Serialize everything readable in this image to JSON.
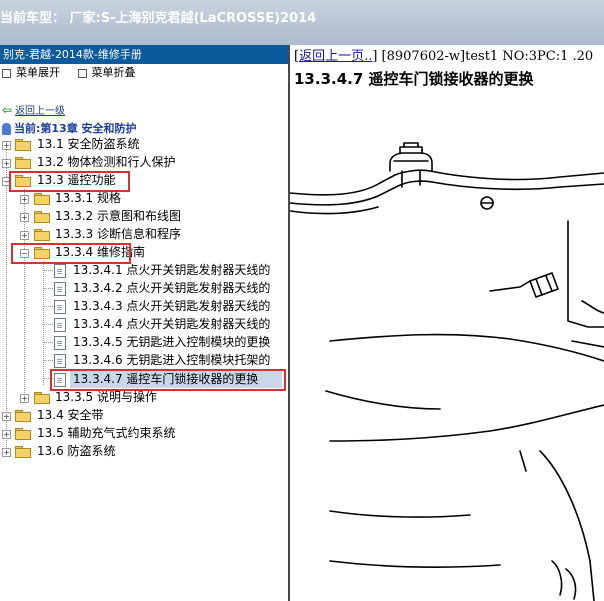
{
  "window": {
    "title": "当前车型： 厂家:S-上海别克君越(LaCROSSE)2014"
  },
  "left_panel": {
    "header": "别克-君越-2014款-维修手册",
    "toolbar": {
      "expand_label": "菜单展开",
      "collapse_label": "菜单折叠"
    },
    "up_link": "返回上一级",
    "current": "当前:第13章 安全和防护",
    "tree": [
      {
        "label": "13.1 安全防盗系统"
      },
      {
        "label": "13.2 物体检测和行人保护"
      },
      {
        "label": "13.3 遥控功能"
      },
      {
        "label": "13.3.1 规格"
      },
      {
        "label": "13.3.2 示意图和布线图"
      },
      {
        "label": "13.3.3 诊断信息和程序"
      },
      {
        "label": "13.3.4 维修指南"
      },
      {
        "label": "13.3.4.1 点火开关钥匙发射器天线的"
      },
      {
        "label": "13.3.4.2 点火开关钥匙发射器天线的"
      },
      {
        "label": "13.3.4.3 点火开关钥匙发射器天线的"
      },
      {
        "label": "13.3.4.4 点火开关钥匙发射器天线的"
      },
      {
        "label": "13.3.4.5 无钥匙进入控制模块的更换"
      },
      {
        "label": "13.3.4.6 无钥匙进入控制模块托架的"
      },
      {
        "label": "13.3.4.7 遥控车门锁接收器的更换"
      },
      {
        "label": "13.3.5 说明与操作"
      },
      {
        "label": "13.4 安全带"
      },
      {
        "label": "13.5 辅助充气式约束系统"
      },
      {
        "label": "13.6 防盗系统"
      }
    ]
  },
  "content": {
    "nav_prefix": "[",
    "back_link": "返回上一页..",
    "nav_info": "] [8907602-w]test1 NO:3PC:1 .20",
    "title": "13.3.4.7 遥控车门锁接收器的更换"
  },
  "colors": {
    "header_blue": "#0a5a9c",
    "highlight_red": "#d93030",
    "selected_bg": "#c9d7ea"
  }
}
